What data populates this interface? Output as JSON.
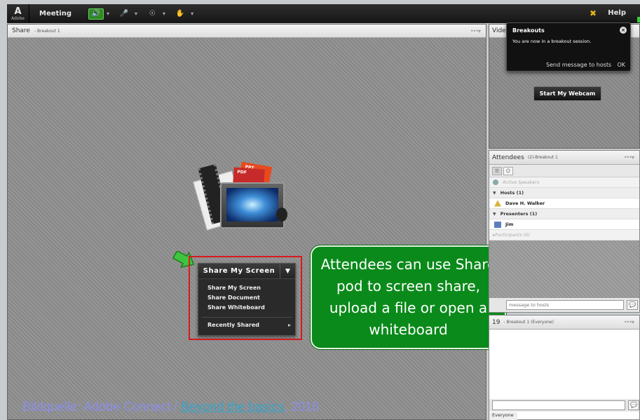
{
  "toolbar": {
    "logo_text": "Adobe",
    "menu_meeting": "Meeting",
    "help": "Help"
  },
  "share_pod": {
    "title": "Share",
    "subtitle": "- Breakout 1",
    "doc_labels": [
      "PPT",
      "PDF"
    ],
    "share_menu": {
      "main_label": "Share My Screen",
      "items": [
        "Share My Screen",
        "Share Document",
        "Share Whiteboard"
      ],
      "recently_shared": "Recently Shared"
    }
  },
  "callout": {
    "text": "Attendees can use Share pod to screen share, upload a file or open a whiteboard"
  },
  "source": {
    "prefix": "Bildquelle: Adobe Connect / ",
    "link": "Beyond the basics",
    "suffix": ", 2016"
  },
  "video_pod": {
    "title": "Vide",
    "webcam_button": "Start My Webcam"
  },
  "breakout_popup": {
    "title": "Breakouts",
    "message": "You are now in a breakout session.",
    "send_message": "Send message to hosts",
    "ok": "OK"
  },
  "attendees_pod": {
    "title": "Attendees",
    "subtitle": "(2)-Breakout 1",
    "active_speakers": "Active Speakers",
    "hosts_group": "Hosts (1)",
    "host_name": "Dave H. Walker",
    "presenters_group": "Presenters (1)",
    "presenter_name": "Jim",
    "participants_group": "Participants (0)",
    "message_placeholder": "message to hosts"
  },
  "chat_pod": {
    "title_fragment": "19",
    "subtitle": "- Breakout 1 (Everyone)",
    "audience": "Everyone"
  },
  "colors": {
    "callout_green": "#0a8a1a",
    "highlight_red": "#d9191c",
    "source_text": "#8c8fe8",
    "source_link": "#3aa3c8"
  }
}
